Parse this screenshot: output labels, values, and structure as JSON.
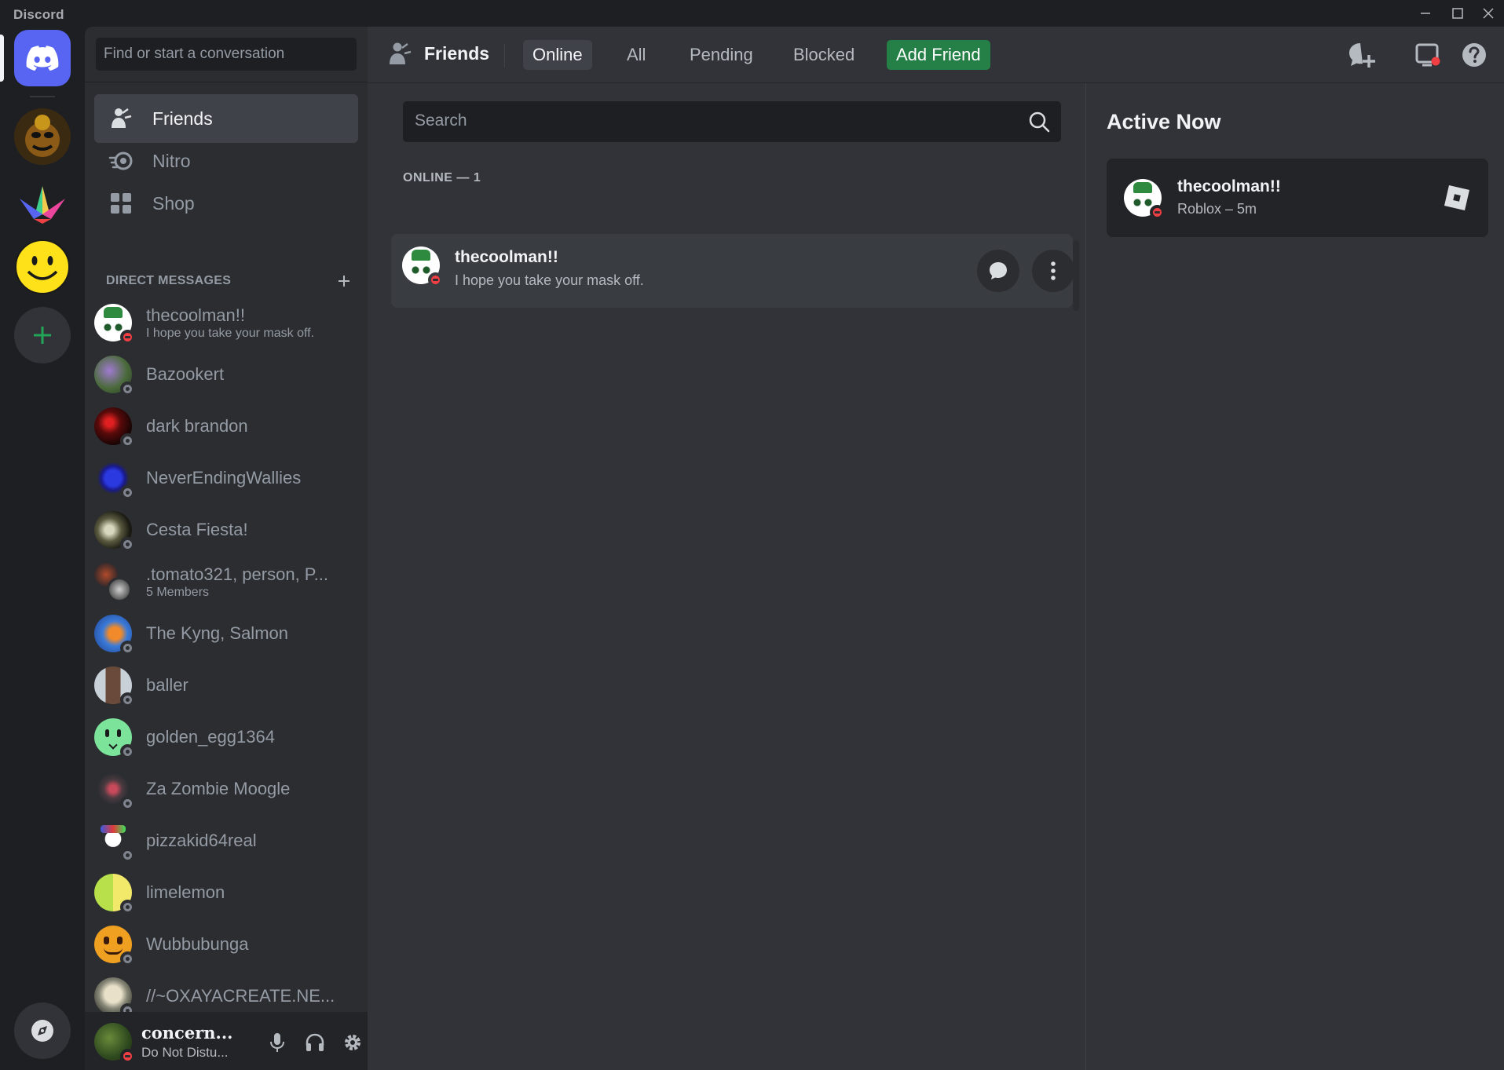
{
  "app": {
    "title": "Discord"
  },
  "dm_sidebar": {
    "search_placeholder": "Find or start a conversation",
    "nav": [
      {
        "label": "Friends",
        "icon": "friends-icon"
      },
      {
        "label": "Nitro",
        "icon": "nitro-icon"
      },
      {
        "label": "Shop",
        "icon": "shop-icon"
      }
    ],
    "dm_header": "DIRECT MESSAGES",
    "dms": [
      {
        "name": "thecoolman!!",
        "sub": "I hope you take your mask off.",
        "status": "dnd"
      },
      {
        "name": "Bazookert",
        "sub": "",
        "status": "offline"
      },
      {
        "name": "dark brandon",
        "sub": "",
        "status": "offline"
      },
      {
        "name": "NeverEndingWallies",
        "sub": "",
        "status": "offline"
      },
      {
        "name": "Cesta Fiesta!",
        "sub": "",
        "status": "offline"
      },
      {
        "name": ".tomato321, person, P...",
        "sub": "5 Members",
        "status": "group"
      },
      {
        "name": "The Kyng, Salmon",
        "sub": "",
        "status": "offline"
      },
      {
        "name": "baller",
        "sub": "",
        "status": "offline"
      },
      {
        "name": "golden_egg1364",
        "sub": "",
        "status": "offline"
      },
      {
        "name": "Za Zombie Moogle",
        "sub": "",
        "status": "offline"
      },
      {
        "name": "pizzakid64real",
        "sub": "",
        "status": "offline"
      },
      {
        "name": "limelemon",
        "sub": "",
        "status": "offline"
      },
      {
        "name": "Wubbubunga",
        "sub": "",
        "status": "offline"
      },
      {
        "name": "//~OXAYACREATE.NE...",
        "sub": "",
        "status": "offline"
      }
    ]
  },
  "user_panel": {
    "name": "concern...",
    "status": "Do Not Distu..."
  },
  "topbar": {
    "title": "Friends",
    "tabs": {
      "online": "Online",
      "all": "All",
      "pending": "Pending",
      "blocked": "Blocked",
      "add_friend": "Add Friend"
    }
  },
  "friends": {
    "search_placeholder": "Search",
    "section_label": "ONLINE — 1",
    "rows": [
      {
        "name": "thecoolman!!",
        "status": "I hope you take your mask off."
      }
    ]
  },
  "active_now": {
    "heading": "Active Now",
    "cards": [
      {
        "name": "thecoolman!!",
        "activity": "Roblox – 5m"
      }
    ]
  },
  "colors": {
    "blurple": "#5865f2",
    "green": "#248046",
    "dnd": "#f23f43",
    "offline": "#80848e"
  }
}
